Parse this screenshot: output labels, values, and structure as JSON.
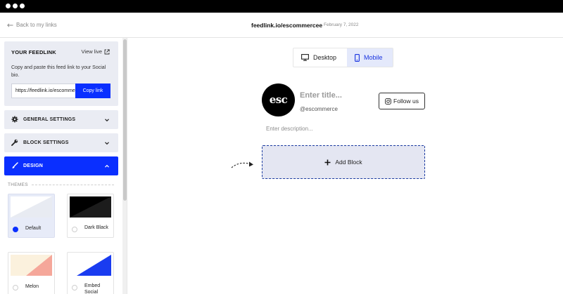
{
  "header": {
    "back_label": "Back to my links",
    "url": "feedlink.io/escommercee",
    "date": "February 7, 2022"
  },
  "sidebar": {
    "feedlink": {
      "title": "YOUR FEEDLINK",
      "view_live_label": "View live",
      "description": "Copy and paste this feed link to your Social bio.",
      "link_value": "https://feedlink.io/escommercee",
      "copy_label": "Copy link"
    },
    "sections": [
      {
        "label": "GENERAL SETTINGS",
        "icon": "gear-icon",
        "expanded": false
      },
      {
        "label": "BLOCK SETTINGS",
        "icon": "wrench-icon",
        "expanded": false
      },
      {
        "label": "DESIGN",
        "icon": "brush-icon",
        "expanded": true
      }
    ],
    "themes_label": "THEMES",
    "themes": [
      {
        "label": "Default",
        "selected": true,
        "colors": [
          "#ffffff",
          "#e8ebf2"
        ]
      },
      {
        "label": "Dark Black",
        "selected": false,
        "colors": [
          "#000000",
          "#1c1c1c"
        ]
      },
      {
        "label": "Melon",
        "selected": false,
        "colors": [
          "#fbf1dd",
          "#f5a79a"
        ]
      },
      {
        "label": "Embed Social",
        "selected": false,
        "colors": [
          "#ffffff",
          "#1a3cf0"
        ]
      }
    ]
  },
  "preview": {
    "toggle": {
      "desktop_label": "Desktop",
      "mobile_label": "Mobile",
      "active": "Mobile"
    },
    "profile": {
      "avatar_text": "esc",
      "title_placeholder": "Enter title...",
      "handle": "@escommerce",
      "follow_label": "Follow us",
      "description_placeholder": "Enter description..."
    },
    "add_block_label": "Add Block"
  },
  "colors": {
    "accent": "#0a2fff",
    "panel": "#eaecf3",
    "selected_theme": "#e7ebf8"
  }
}
